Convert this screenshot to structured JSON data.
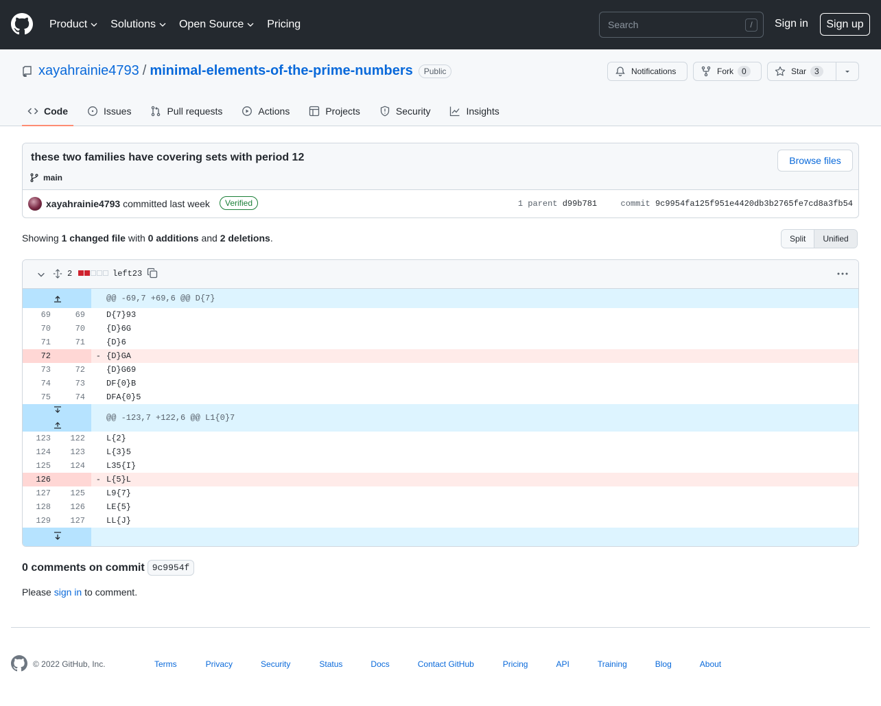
{
  "header": {
    "nav": [
      "Product",
      "Solutions",
      "Open Source",
      "Pricing"
    ],
    "search_placeholder": "Search",
    "search_shortcut": "/",
    "sign_in": "Sign in",
    "sign_up": "Sign up"
  },
  "repo": {
    "owner": "xayahrainie4793",
    "separator": "/",
    "name": "minimal-elements-of-the-prime-numbers",
    "visibility": "Public",
    "notifications_label": "Notifications",
    "fork_label": "Fork",
    "fork_count": "0",
    "star_label": "Star",
    "star_count": "3",
    "tabs": [
      "Code",
      "Issues",
      "Pull requests",
      "Actions",
      "Projects",
      "Security",
      "Insights"
    ]
  },
  "commit": {
    "title": "these two families have covering sets with period 12",
    "branch": "main",
    "browse_files": "Browse files",
    "author": "xayahrainie4793",
    "committed": "committed last week",
    "verified": "Verified",
    "parent_label": "1 parent",
    "parent_sha": "d99b781",
    "commit_label": "commit",
    "commit_sha": "9c9954fa125f951e4420db3b2765fe7cd8a3fb54"
  },
  "summary": {
    "showing": "Showing",
    "changed": "1 changed file",
    "with": "with",
    "additions": "0 additions",
    "and": "and",
    "deletions": "2 deletions",
    "period": ".",
    "split": "Split",
    "unified": "Unified"
  },
  "diff": {
    "count": "2",
    "filename": "left23",
    "hunk1": "@@ -69,7 +69,6 @@ D{7}",
    "hunk2": "@@ -123,7 +122,6 @@ L1{0}7",
    "rows1": [
      {
        "l": "69",
        "r": "69",
        "m": "",
        "code": "D{7}93",
        "del": false
      },
      {
        "l": "70",
        "r": "70",
        "m": "",
        "code": "{D}6G",
        "del": false
      },
      {
        "l": "71",
        "r": "71",
        "m": "",
        "code": "{D}6",
        "del": false
      },
      {
        "l": "72",
        "r": "",
        "m": "-",
        "code": "{D}GA",
        "del": true
      },
      {
        "l": "73",
        "r": "72",
        "m": "",
        "code": "{D}G69",
        "del": false
      },
      {
        "l": "74",
        "r": "73",
        "m": "",
        "code": "DF{0}B",
        "del": false
      },
      {
        "l": "75",
        "r": "74",
        "m": "",
        "code": "DFA{0}5",
        "del": false
      }
    ],
    "rows2": [
      {
        "l": "123",
        "r": "122",
        "m": "",
        "code": "L{2}",
        "del": false
      },
      {
        "l": "124",
        "r": "123",
        "m": "",
        "code": "L{3}5",
        "del": false
      },
      {
        "l": "125",
        "r": "124",
        "m": "",
        "code": "L35{I}",
        "del": false
      },
      {
        "l": "126",
        "r": "",
        "m": "-",
        "code": "L{5}L",
        "del": true
      },
      {
        "l": "127",
        "r": "125",
        "m": "",
        "code": "L9{7}",
        "del": false
      },
      {
        "l": "128",
        "r": "126",
        "m": "",
        "code": "LE{5}",
        "del": false
      },
      {
        "l": "129",
        "r": "127",
        "m": "",
        "code": "LL{J}",
        "del": false
      }
    ]
  },
  "comments": {
    "title": "0 comments on commit",
    "sha": "9c9954f",
    "please": "Please",
    "sign_in": "sign in",
    "to_comment": "to comment."
  },
  "footer": {
    "copyright": "© 2022 GitHub, Inc.",
    "links": [
      "Terms",
      "Privacy",
      "Security",
      "Status",
      "Docs",
      "Contact GitHub",
      "Pricing",
      "API",
      "Training",
      "Blog",
      "About"
    ]
  }
}
